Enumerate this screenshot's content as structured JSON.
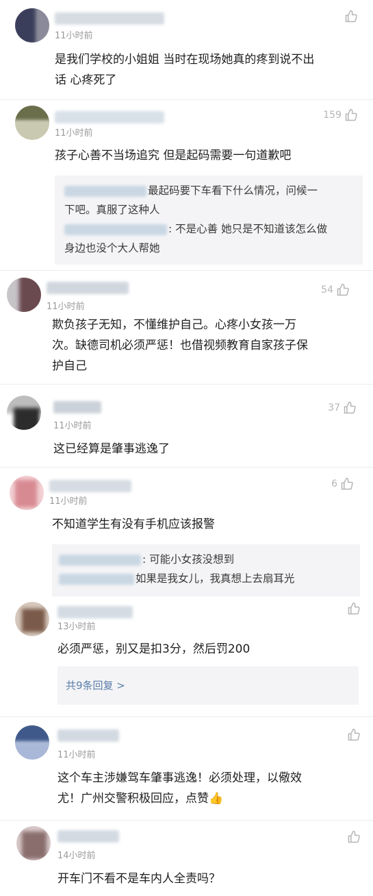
{
  "comments": [
    {
      "time": "11小时前",
      "like_count": "",
      "text_lines": [
        "是我们学校的小姐姐 当时在现场她真的疼到说不出",
        "话 心疼死了"
      ],
      "avatar_colors": [
        "#3b3e5a",
        "#8a8a9a"
      ]
    },
    {
      "time": "11小时前",
      "like_count": "159",
      "text_lines": [
        "孩子心善不当场追究 但是起码需要一句道歉吧"
      ],
      "avatar_colors": [
        "#6b6e4a",
        "#c9c8b0"
      ],
      "replies": [
        [
          "最起码要下车看下什么情况，问候一",
          "下吧。真服了这种人"
        ],
        [
          ": 不是心善 她只是不知道该怎么做",
          "身边也没个大人帮她"
        ]
      ]
    },
    {
      "time": "11小时前",
      "like_count": "54",
      "text_lines": [
        "欺负孩子无知，不懂维护自己。心疼小女孩一万",
        "次。缺德司机必须严惩！也借视频教育自家孩子保",
        "护自己"
      ],
      "avatar_colors": [
        "#6a4a4e",
        "#c7c4c8"
      ]
    },
    {
      "time": "11小时前",
      "like_count": "37",
      "text_lines": [
        "这已经算是肇事逃逸了"
      ],
      "avatar_colors": [
        "#2c2c2c",
        "#bdbdbd"
      ]
    },
    {
      "time": "11小时前",
      "like_count": "6",
      "text_lines": [
        "不知道学生有没有手机应该报警"
      ],
      "avatar_colors": [
        "#d88a92",
        "#f2d0d4"
      ],
      "replies": [
        [
          ": 可能小女孩没想到"
        ],
        [
          "如果是我女儿，我真想上去扇耳光"
        ]
      ]
    },
    {
      "time": "13小时前",
      "like_count": "",
      "text_lines": [
        "必须严惩，别又是扣3分，然后罚200"
      ],
      "avatar_colors": [
        "#7a5a4a",
        "#d6c8bc"
      ],
      "more_replies": "共9条回复 >"
    },
    {
      "time": "11小时前",
      "like_count": "",
      "text_lines": [
        "这个车主涉嫌驾车肇事逃逸！必须处理，以儆效",
        "尤！广州交警积极回应，点赞👍"
      ],
      "avatar_colors": [
        "#3f5a8a",
        "#a9b8d8"
      ]
    },
    {
      "time": "14小时前",
      "like_count": "",
      "text_lines": [
        "开车门不看不是车内人全责吗？"
      ],
      "avatar_colors": [
        "#8a6e6e",
        "#d8c8c8"
      ]
    }
  ],
  "icons": {
    "like": "thumbs-up-icon"
  },
  "colors": {
    "time": "#9a9a9a",
    "reply_bg": "#f4f4f6",
    "more_link": "#5a7eaa"
  }
}
